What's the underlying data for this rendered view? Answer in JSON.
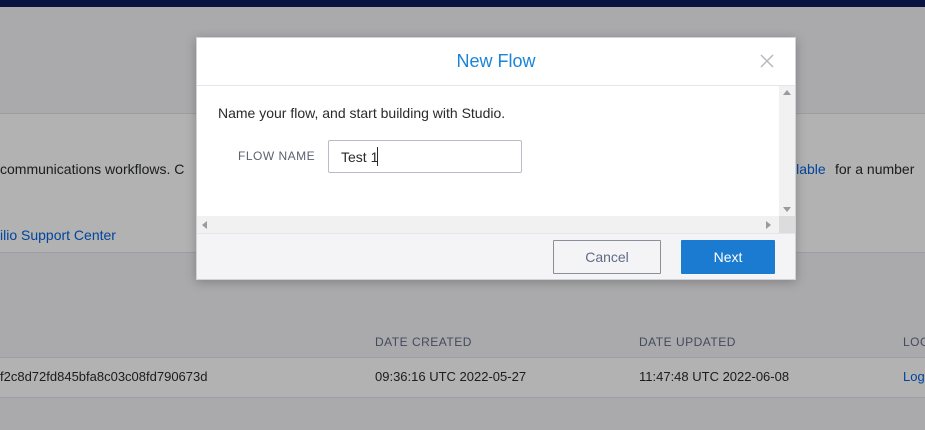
{
  "background": {
    "description_fragment": "communications workflows. C",
    "available_link_fragment": "ilable",
    "available_suffix": "for a number",
    "support_link": "ilio Support Center",
    "table": {
      "headers": [
        "DATE CREATED",
        "DATE UPDATED",
        "LOG"
      ],
      "row": {
        "sid_fragment": "f2c8d72fd845bfa8c03c08fd790673d",
        "date_created": "09:36:16 UTC 2022-05-27",
        "date_updated": "11:47:48 UTC 2022-06-08",
        "log_link": "Log"
      }
    }
  },
  "modal": {
    "title": "New Flow",
    "intro": "Name your flow, and start building with Studio.",
    "field_label": "FLOW NAME",
    "field_value": "Test 1",
    "cancel_label": "Cancel",
    "next_label": "Next"
  },
  "colors": {
    "accent": "#1a7bd0",
    "title_blue": "#1a84d8",
    "topbar": "#0d1a5c"
  }
}
